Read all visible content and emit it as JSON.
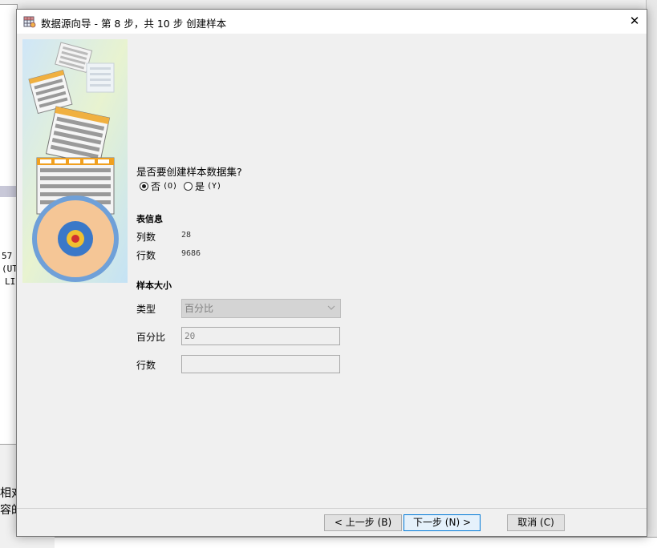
{
  "background": {
    "fragments": [
      "57",
      "(UT",
      "LI"
    ],
    "text_fragments": [
      "相对",
      "容的"
    ]
  },
  "dialog": {
    "title": "数据源向导 - 第 8 步，共 10 步 创建样本",
    "close_glyph": "✕"
  },
  "question": {
    "label": "是否要创建样本数据集?",
    "options": [
      {
        "label": "否",
        "mnemonic": "(O)",
        "selected": true
      },
      {
        "label": "是",
        "mnemonic": "(Y)",
        "selected": false
      }
    ]
  },
  "table_info": {
    "heading": "表信息",
    "columns_label": "列数",
    "columns_value": "28",
    "rows_label": "行数",
    "rows_value": "9686"
  },
  "sample_size": {
    "heading": "样本大小",
    "type_label": "类型",
    "type_value": "百分比",
    "percent_label": "百分比",
    "percent_value": "20",
    "rows_label": "行数",
    "rows_value": ""
  },
  "buttons": {
    "back": "< 上一步 (B)",
    "next": "下一步 (N) >",
    "cancel": "取消 (C)"
  },
  "colors": {
    "accent": "#0078d7",
    "dialog_bg": "#f0f0f0"
  },
  "icons": [
    "wizard-app-icon",
    "close-icon",
    "chevron-down-icon"
  ]
}
